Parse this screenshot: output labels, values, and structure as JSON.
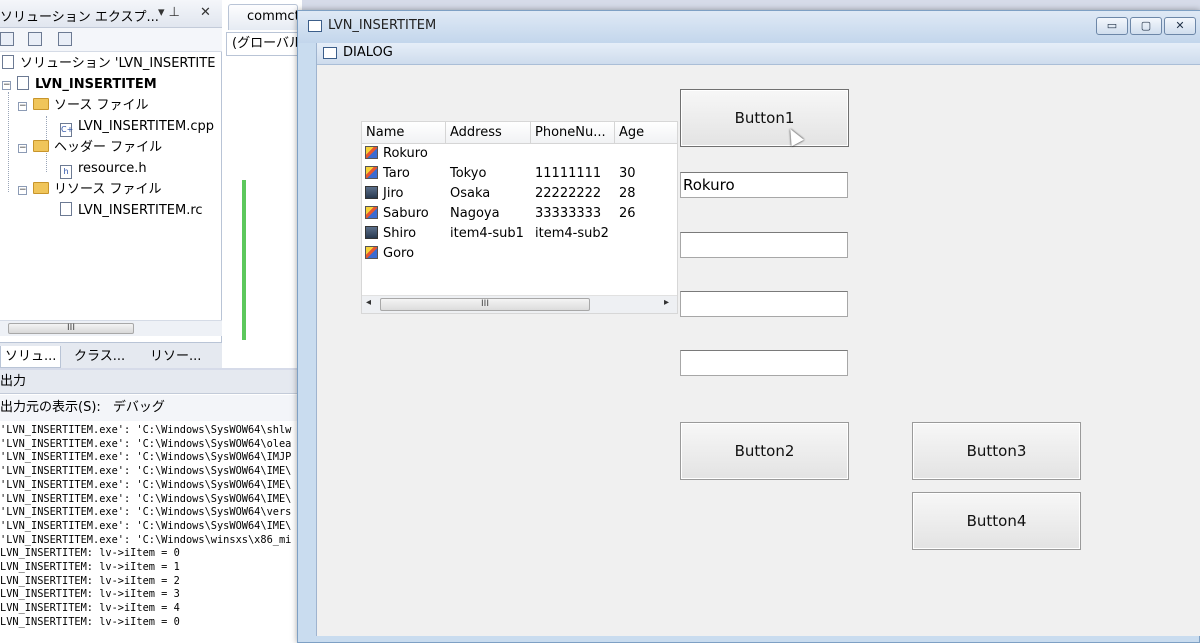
{
  "solution_explorer": {
    "title": "ソリューション エクスプ...",
    "pin_glyph": "▾ ⊥",
    "close_glyph": "✕",
    "tree": [
      {
        "label": "ソリューション 'LVN_INSERTITE",
        "level": 0,
        "bold": false
      },
      {
        "label": "LVN_INSERTITEM",
        "level": 0,
        "bold": true
      },
      {
        "label": "ソース ファイル",
        "level": 1
      },
      {
        "label": "LVN_INSERTITEM.cpp",
        "level": 2
      },
      {
        "label": "ヘッダー ファイル",
        "level": 1
      },
      {
        "label": "resource.h",
        "level": 2
      },
      {
        "label": "リソース ファイル",
        "level": 1
      },
      {
        "label": "LVN_INSERTITEM.rc",
        "level": 2
      }
    ],
    "scroll_thumb": "III",
    "tabs": [
      "ソリュ...",
      "クラス...",
      "リソー..."
    ]
  },
  "editor": {
    "tab_label": "commct",
    "combo_value": "(グローバル"
  },
  "output": {
    "title": "出力",
    "source_label": "出力元の表示(S):",
    "source_value": "デバッグ",
    "lines": [
      "'LVN_INSERTITEM.exe': 'C:\\Windows\\SysWOW64\\shlw",
      "'LVN_INSERTITEM.exe': 'C:\\Windows\\SysWOW64\\olea",
      "'LVN_INSERTITEM.exe': 'C:\\Windows\\SysWOW64\\IMJP",
      "'LVN_INSERTITEM.exe': 'C:\\Windows\\SysWOW64\\IME\\",
      "'LVN_INSERTITEM.exe': 'C:\\Windows\\SysWOW64\\IME\\",
      "'LVN_INSERTITEM.exe': 'C:\\Windows\\SysWOW64\\IME\\",
      "'LVN_INSERTITEM.exe': 'C:\\Windows\\SysWOW64\\vers",
      "'LVN_INSERTITEM.exe': 'C:\\Windows\\SysWOW64\\IME\\",
      "'LVN_INSERTITEM.exe': 'C:\\Windows\\winsxs\\x86_mi",
      "LVN_INSERTITEM: lv->iItem = 0",
      "LVN_INSERTITEM: lv->iItem = 1",
      "LVN_INSERTITEM: lv->iItem = 2",
      "LVN_INSERTITEM: lv->iItem = 3",
      "LVN_INSERTITEM: lv->iItem = 4",
      "LVN_INSERTITEM: lv->iItem = 0"
    ]
  },
  "window": {
    "title": "LVN_INSERTITEM",
    "minimize_glyph": "▭",
    "maximize_glyph": "▢",
    "close_glyph": "✕",
    "dialog_title": "DIALOG"
  },
  "listview": {
    "columns": [
      "Name",
      "Address",
      "PhoneNu...",
      "Age"
    ],
    "rows": [
      {
        "icon": "pencil-icon",
        "name": "Rokuro",
        "address": "",
        "phone": "",
        "age": ""
      },
      {
        "icon": "pencil-icon",
        "name": "Taro",
        "address": "Tokyo",
        "phone": "11111111",
        "age": "30"
      },
      {
        "icon": "monitor-icon",
        "name": "Jiro",
        "address": "Osaka",
        "phone": "22222222",
        "age": "28"
      },
      {
        "icon": "pencil-icon",
        "name": "Saburo",
        "address": "Nagoya",
        "phone": "33333333",
        "age": "26"
      },
      {
        "icon": "monitor-icon",
        "name": "Shiro",
        "address": "item4-sub1",
        "phone": "item4-sub2",
        "age": ""
      },
      {
        "icon": "pencil-icon",
        "name": "Goro",
        "address": "",
        "phone": "",
        "age": ""
      }
    ],
    "scroll_thumb": "III",
    "scroll_left": "◂",
    "scroll_right": "▸"
  },
  "buttons": {
    "button1": "Button1",
    "button2": "Button2",
    "button3": "Button3",
    "button4": "Button4"
  },
  "edits": [
    "Rokuro",
    "",
    "",
    ""
  ]
}
